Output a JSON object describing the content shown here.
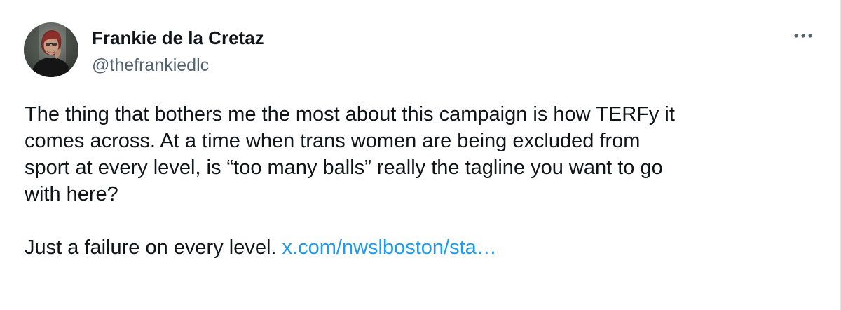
{
  "author": {
    "display_name": "Frankie de la Cretaz",
    "handle": "@thefrankiedlc"
  },
  "icons": {
    "avatar": "profile-photo",
    "more": "more-horizontal-icon"
  },
  "tweet": {
    "text_paragraph_1": "The thing that bothers me the most about this campaign is how TERFy it\ncomes across. At a time when trans women are being excluded from\nsport at every level, is “too many balls” really the tagline you want to go\nwith here?",
    "text_paragraph_2_prefix": "Just a failure on every level.",
    "link_text": "x.com/nwslboston/sta…"
  },
  "colors": {
    "text": "#0f1419",
    "secondary": "#536471",
    "link": "#1d9bf0"
  }
}
